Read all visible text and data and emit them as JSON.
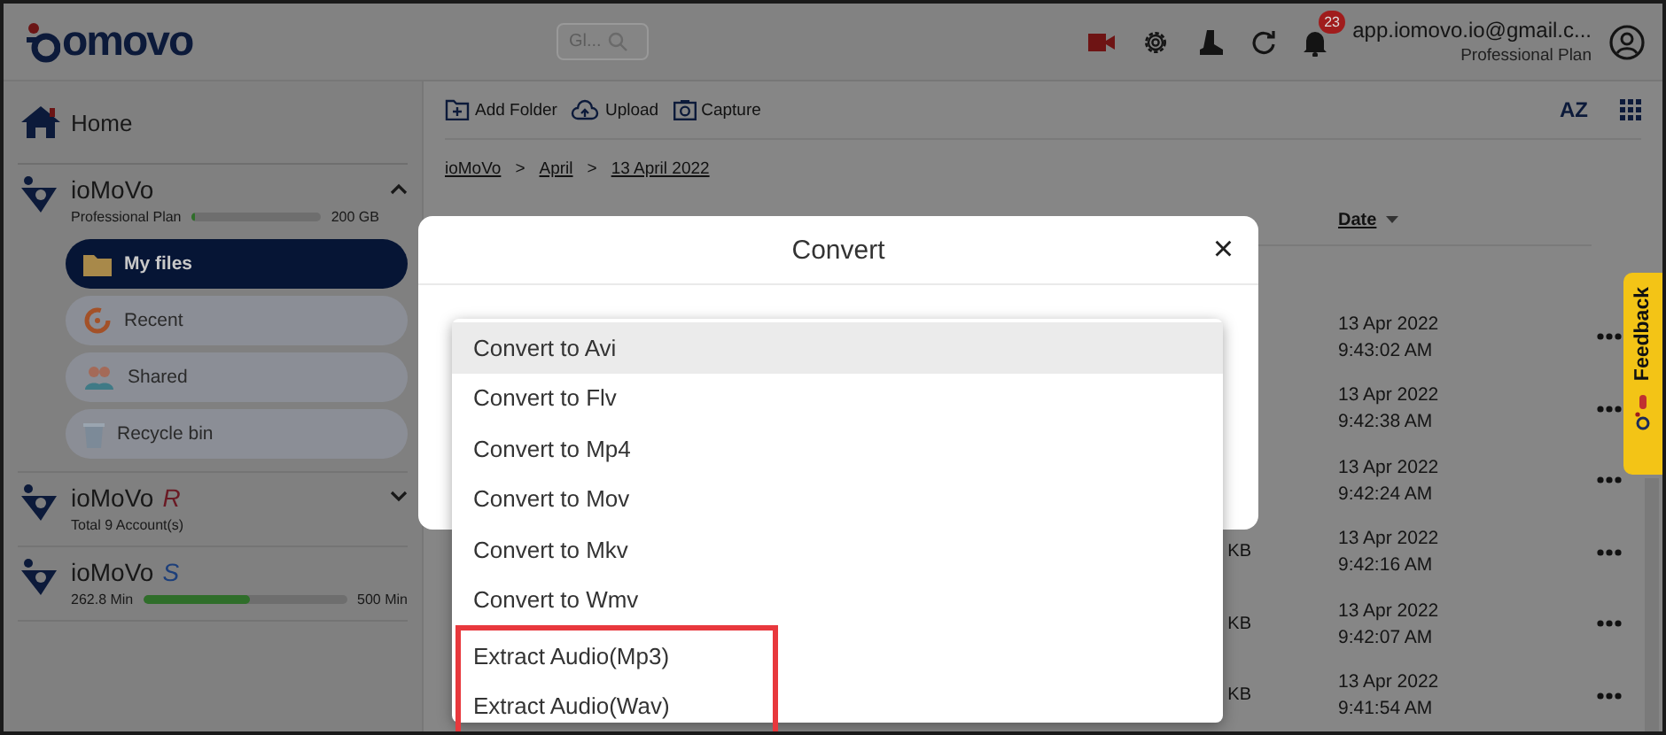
{
  "header": {
    "logo": "omovo",
    "search": {
      "placeholder": "Gl..."
    },
    "notifications": {
      "badge": "23"
    },
    "account": {
      "email": "app.iomovo.io@gmail.c...",
      "plan": "Professional Plan"
    }
  },
  "sidebar": {
    "home": "Home",
    "workspaces": [
      {
        "kind": "storage",
        "name": "ioMoVo",
        "subtitle": "Professional Plan",
        "level": 0.03,
        "capacity": "200 GB",
        "expanded": true,
        "nav": [
          {
            "label": "My files",
            "kind": "folder",
            "selected": true
          },
          {
            "label": "Recent",
            "kind": "recent",
            "selected": false
          },
          {
            "label": "Shared",
            "kind": "shared",
            "selected": false
          },
          {
            "label": "Recycle bin",
            "kind": "bin",
            "selected": false
          }
        ]
      },
      {
        "kind": "accounts",
        "name": "ioMoVo",
        "suffix": "R",
        "subtitle": "Total 9 Account(s)",
        "expanded": false
      },
      {
        "kind": "minutes",
        "name": "ioMoVo",
        "suffix": "S",
        "used": "262.8 Min",
        "level": 0.52,
        "capacity": "500 Min"
      }
    ]
  },
  "toolbar": {
    "actions": [
      {
        "label": "Add Folder",
        "kind": "folder"
      },
      {
        "label": "Upload",
        "kind": "upload"
      },
      {
        "label": "Capture",
        "kind": "camera"
      }
    ],
    "sort_label": "AZ"
  },
  "breadcrumb": {
    "items": [
      "ioMoVo",
      "April",
      "13 April 2022"
    ],
    "separators": [
      ">",
      ">"
    ]
  },
  "table": {
    "columns": [
      "Date"
    ],
    "rows": [
      {
        "date": "13 Apr 2022",
        "time": "9:43:02 AM"
      },
      {
        "date": "13 Apr 2022",
        "time": "9:42:38 AM"
      },
      {
        "date": "13 Apr 2022",
        "time": "9:42:24 AM"
      },
      {
        "column_size": "KB",
        "date": "13 Apr 2022",
        "time": "9:42:16 AM"
      },
      {
        "column_size": "KB",
        "date": "13 Apr 2022",
        "time": "9:42:07 AM"
      },
      {
        "column_size": "KB",
        "date": "13 Apr 2022",
        "time": "9:41:54 AM"
      }
    ]
  },
  "feedback": {
    "label": "Feedback"
  },
  "dialog": {
    "title": "Convert",
    "close": "×",
    "options": [
      {
        "label": "Convert to Avi",
        "selected": true,
        "highlighted": false
      },
      {
        "label": "Convert to Flv",
        "selected": false,
        "highlighted": false
      },
      {
        "label": "Convert to Mp4",
        "selected": false,
        "highlighted": false
      },
      {
        "label": "Convert to Mov",
        "selected": false,
        "highlighted": false
      },
      {
        "label": "Convert to Mkv",
        "selected": false,
        "highlighted": false
      },
      {
        "label": "Convert to Wmv",
        "selected": false,
        "highlighted": false
      },
      {
        "label": "Extract Audio(Mp3)",
        "selected": false,
        "highlighted": true
      },
      {
        "label": "Extract Audio(Wav)",
        "selected": false,
        "highlighted": true
      }
    ]
  }
}
